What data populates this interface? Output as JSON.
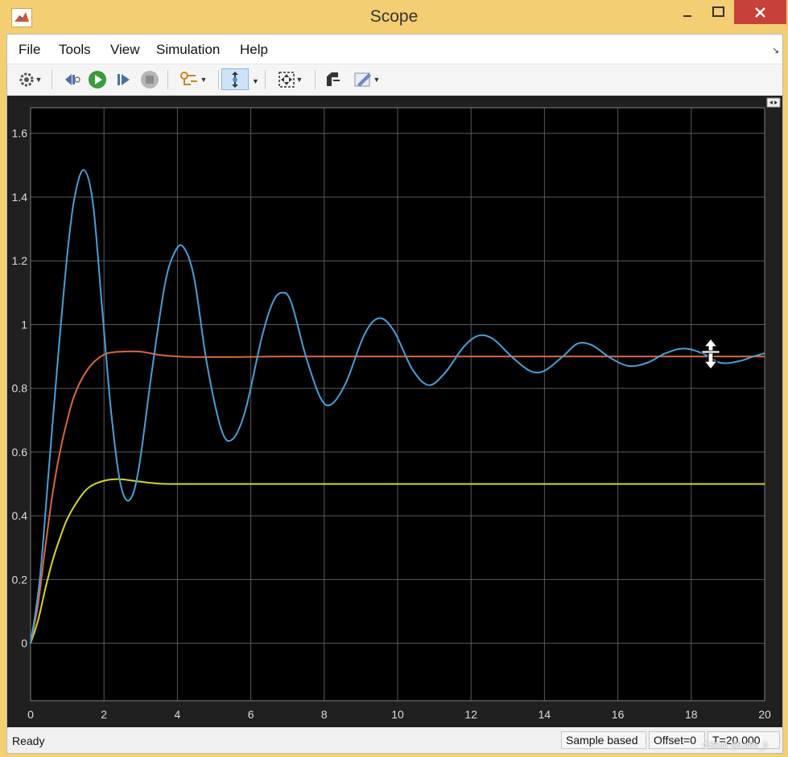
{
  "window": {
    "title": "Scope"
  },
  "menu": {
    "items": [
      {
        "label": "File"
      },
      {
        "label": "Tools"
      },
      {
        "label": "View"
      },
      {
        "label": "Simulation"
      },
      {
        "label": "Help"
      }
    ]
  },
  "toolbar": {
    "icons": [
      "gear-icon",
      "step-back-icon",
      "run-icon",
      "step-forward-icon",
      "stop-icon",
      "highlight-icon",
      "zoom-icon",
      "fit-to-view-icon",
      "cursor-measure-icon",
      "style-icon"
    ]
  },
  "status": {
    "ready": "Ready",
    "mode": "Sample based",
    "offset": "Offset=0",
    "time": "T=20.000"
  },
  "watermark": "CSDN @Little_9",
  "colors": {
    "plot_background": "#000000",
    "axes_panel": "#202020",
    "grid": "#5a5a5a",
    "tick_labels": "#dcdcdc",
    "series_blue": "#4a9fd8",
    "series_orange": "#d8693a",
    "series_yellow": "#d8d42a",
    "window_frame": "#f3ce72",
    "close_button": "#c7403a"
  },
  "chart_data": {
    "type": "line",
    "x_ticks": [
      "0",
      "2",
      "4",
      "6",
      "8",
      "10",
      "12",
      "14",
      "16",
      "18",
      "20"
    ],
    "y_ticks": [
      "0",
      "0.2",
      "0.4",
      "0.6",
      "0.8",
      "1",
      "1.2",
      "1.4",
      "1.6"
    ],
    "xlim": [
      0,
      20
    ],
    "ylim": [
      -0.18,
      1.68
    ],
    "grid": true,
    "series": [
      {
        "color": "#4a9fd8",
        "points": [
          [
            0,
            0
          ],
          [
            0.25,
            0.2
          ],
          [
            0.5,
            0.55
          ],
          [
            0.75,
            0.9
          ],
          [
            1.0,
            1.22
          ],
          [
            1.2,
            1.4
          ],
          [
            1.45,
            1.485
          ],
          [
            1.7,
            1.38
          ],
          [
            1.95,
            1.05
          ],
          [
            2.2,
            0.72
          ],
          [
            2.45,
            0.5
          ],
          [
            2.7,
            0.45
          ],
          [
            2.95,
            0.55
          ],
          [
            3.3,
            0.85
          ],
          [
            3.65,
            1.12
          ],
          [
            3.9,
            1.22
          ],
          [
            4.15,
            1.245
          ],
          [
            4.45,
            1.15
          ],
          [
            4.8,
            0.88
          ],
          [
            5.2,
            0.67
          ],
          [
            5.5,
            0.64
          ],
          [
            5.85,
            0.73
          ],
          [
            6.3,
            0.96
          ],
          [
            6.6,
            1.07
          ],
          [
            6.85,
            1.1
          ],
          [
            7.1,
            1.07
          ],
          [
            7.5,
            0.9
          ],
          [
            7.9,
            0.77
          ],
          [
            8.2,
            0.75
          ],
          [
            8.6,
            0.82
          ],
          [
            9.1,
            0.97
          ],
          [
            9.5,
            1.02
          ],
          [
            9.9,
            0.98
          ],
          [
            10.4,
            0.86
          ],
          [
            10.85,
            0.81
          ],
          [
            11.3,
            0.85
          ],
          [
            11.8,
            0.93
          ],
          [
            12.2,
            0.965
          ],
          [
            12.6,
            0.955
          ],
          [
            13.1,
            0.9
          ],
          [
            13.6,
            0.855
          ],
          [
            14.0,
            0.855
          ],
          [
            14.5,
            0.9
          ],
          [
            14.9,
            0.94
          ],
          [
            15.3,
            0.935
          ],
          [
            15.8,
            0.895
          ],
          [
            16.3,
            0.87
          ],
          [
            16.8,
            0.88
          ],
          [
            17.3,
            0.91
          ],
          [
            17.8,
            0.925
          ],
          [
            18.3,
            0.91
          ],
          [
            18.8,
            0.88
          ],
          [
            19.3,
            0.885
          ],
          [
            19.7,
            0.9
          ],
          [
            20.0,
            0.91
          ]
        ]
      },
      {
        "color": "#d8693a",
        "points": [
          [
            0,
            0
          ],
          [
            0.2,
            0.12
          ],
          [
            0.4,
            0.3
          ],
          [
            0.6,
            0.47
          ],
          [
            0.8,
            0.6
          ],
          [
            1.0,
            0.7
          ],
          [
            1.2,
            0.78
          ],
          [
            1.5,
            0.85
          ],
          [
            1.8,
            0.89
          ],
          [
            2.1,
            0.91
          ],
          [
            2.5,
            0.915
          ],
          [
            3.0,
            0.915
          ],
          [
            3.5,
            0.905
          ],
          [
            4.0,
            0.9
          ],
          [
            4.5,
            0.898
          ],
          [
            5.5,
            0.898
          ],
          [
            7,
            0.9
          ],
          [
            10,
            0.9
          ],
          [
            14,
            0.9
          ],
          [
            20,
            0.9
          ]
        ]
      },
      {
        "color": "#d8d42a",
        "points": [
          [
            0,
            0
          ],
          [
            0.2,
            0.07
          ],
          [
            0.4,
            0.17
          ],
          [
            0.6,
            0.26
          ],
          [
            0.8,
            0.33
          ],
          [
            1.0,
            0.39
          ],
          [
            1.3,
            0.45
          ],
          [
            1.6,
            0.49
          ],
          [
            2.0,
            0.51
          ],
          [
            2.4,
            0.515
          ],
          [
            2.8,
            0.51
          ],
          [
            3.3,
            0.503
          ],
          [
            3.8,
            0.5
          ],
          [
            5,
            0.5
          ],
          [
            8,
            0.5
          ],
          [
            12,
            0.5
          ],
          [
            20,
            0.5
          ]
        ]
      }
    ]
  }
}
